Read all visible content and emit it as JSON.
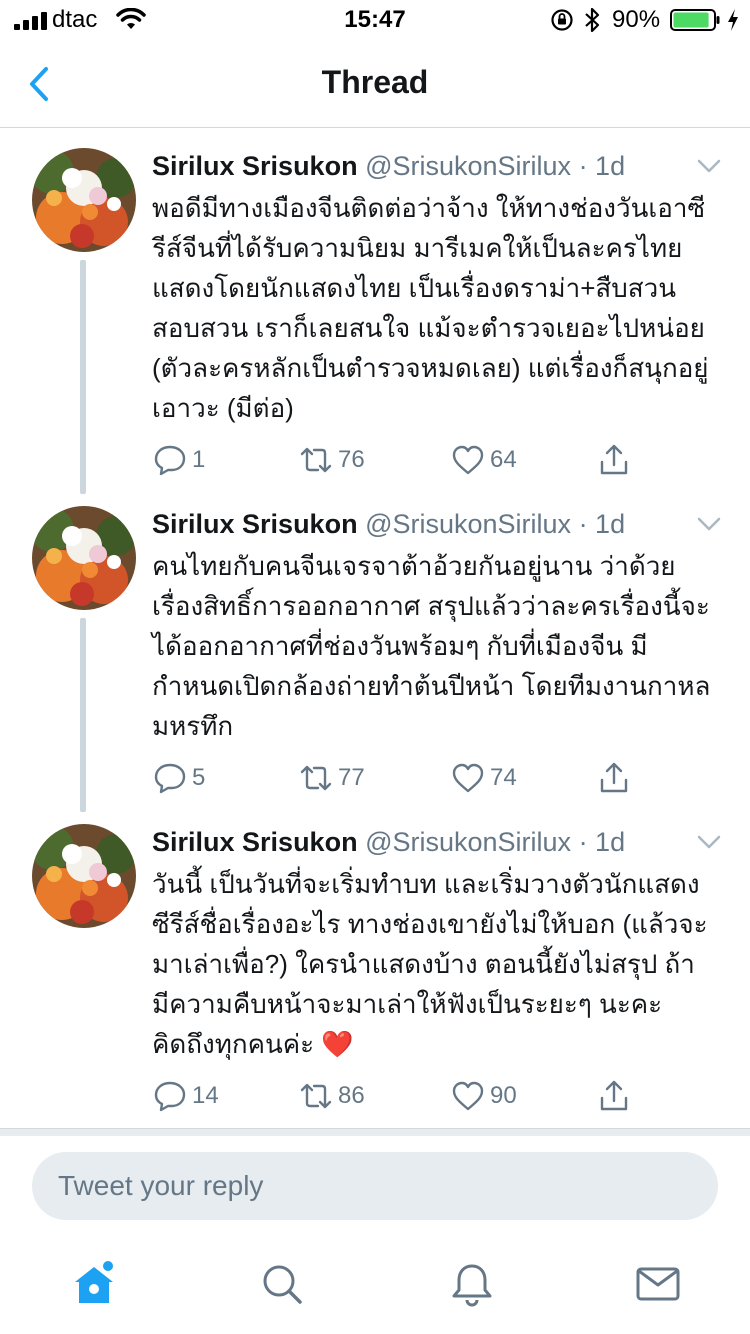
{
  "status_bar": {
    "carrier": "dtac",
    "time": "15:47",
    "battery_percent": "90%",
    "battery_level": 0.9,
    "icons": [
      "signal-icon",
      "wifi-icon",
      "rotation-lock-icon",
      "bluetooth-icon",
      "battery-icon",
      "charging-icon"
    ]
  },
  "header": {
    "title": "Thread",
    "back_icon": "chevron-left-icon"
  },
  "tweets": [
    {
      "name": "Sirilux Srisukon",
      "handle": "@SrisukonSirilux",
      "time": "· 1d",
      "text": "พอดีมีทางเมืองจีนติดต่อว่าจ้าง ให้ทางช่องวันเอาซีรีส์จีนที่ได้รับความนิยม มารีเมคให้เป็นละครไทย แสดงโดยนักแสดงไทย เป็นเรื่องดราม่า+สืบสวนสอบสวน เราก็เลยสนใจ แม้จะตำรวจเยอะไปหน่อย (ตัวละครหลักเป็นตำรวจหมดเลย) แต่เรื่องก็สนุกอยู่ เอาวะ (มีต่อ)",
      "replies": "1",
      "retweets": "76",
      "likes": "64"
    },
    {
      "name": "Sirilux Srisukon",
      "handle": "@SrisukonSirilux",
      "time": "· 1d",
      "text": "คนไทยกับคนจีนเจรจาต้าอ้วยกันอยู่นาน ว่าด้วยเรื่องสิทธิ์การออกอากาศ สรุปแล้วว่าละครเรื่องนี้จะได้ออกอากาศที่ช่องวันพร้อมๆ กับที่เมืองจีน มีกำหนดเปิดกล้องถ่ายทำต้นปีหน้า โดยทีมงานกาหลมหรทึก",
      "replies": "5",
      "retweets": "77",
      "likes": "74"
    },
    {
      "name": "Sirilux Srisukon",
      "handle": "@SrisukonSirilux",
      "time": "· 1d",
      "text": "วันนี้ เป็นวันที่จะเริ่มทำบท และเริ่มวางตัวนักแสดง ซีรีส์ชื่อเรื่องอะไร ทางช่องเขายังไม่ให้บอก (แล้วจะมาเล่าเพื่อ?) ใครนำแสดงบ้าง ตอนนี้ยังไม่สรุป ถ้ามีความคืบหน้าจะมาเล่าให้ฟังเป็นระยะๆ นะคะ คิดถึงทุกคนค่ะ ❤️",
      "replies": "14",
      "retweets": "86",
      "likes": "90"
    }
  ],
  "reply": {
    "placeholder": "Tweet your reply"
  },
  "tabbar": {
    "items": [
      "home-icon",
      "search-icon",
      "notifications-icon",
      "messages-icon"
    ]
  },
  "colors": {
    "accent": "#1da1f2",
    "text": "#14171a",
    "secondary": "#657786",
    "battery": "#4cd964"
  }
}
